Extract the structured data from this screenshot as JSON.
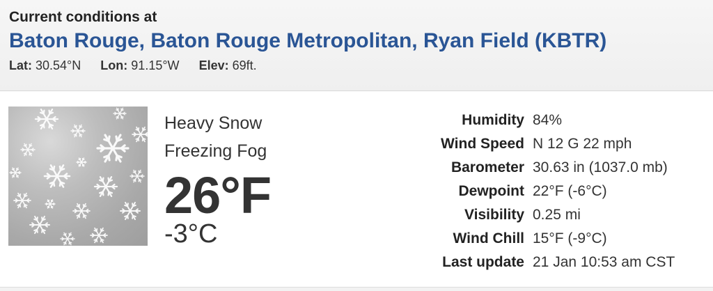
{
  "header": {
    "label": "Current conditions at",
    "station": "Baton Rouge, Baton Rouge Metropolitan, Ryan Field (KBTR)",
    "lat_label": "Lat:",
    "lat_value": "30.54°N",
    "lon_label": "Lon:",
    "lon_value": "91.15°W",
    "elev_label": "Elev:",
    "elev_value": "69ft."
  },
  "conditions": {
    "icon": "snowflake-icon",
    "line1": "Heavy Snow",
    "line2": "Freezing Fog",
    "temp_f": "26°F",
    "temp_c": "-3°C"
  },
  "details": [
    {
      "label": "Humidity",
      "value": "84%"
    },
    {
      "label": "Wind Speed",
      "value": "N 12 G 22 mph"
    },
    {
      "label": "Barometer",
      "value": "30.63 in (1037.0 mb)"
    },
    {
      "label": "Dewpoint",
      "value": "22°F (-6°C)"
    },
    {
      "label": "Visibility",
      "value": "0.25 mi"
    },
    {
      "label": "Wind Chill",
      "value": "15°F (-9°C)"
    },
    {
      "label": "Last update",
      "value": "21 Jan 10:53 am CST"
    }
  ],
  "colors": {
    "station_link": "#2a5595",
    "header_bg": "#f2f2f2"
  }
}
